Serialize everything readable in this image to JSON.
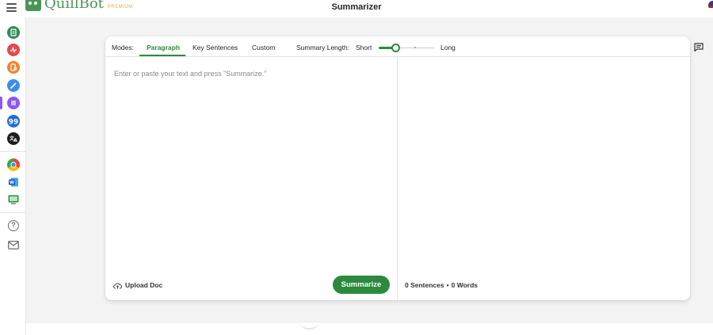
{
  "header": {
    "logo_text": "QuillBot",
    "logo_badge": "PREMIUM",
    "page_title": "Summarizer"
  },
  "sidebar": {
    "items": [
      {
        "name": "paraphraser",
        "icon": "document-icon",
        "color": "#2e8b57"
      },
      {
        "name": "grammar-checker",
        "icon": "pulse-icon",
        "color": "#e24b4b"
      },
      {
        "name": "plagiarism-checker",
        "icon": "report-icon",
        "color": "#f0842d"
      },
      {
        "name": "co-writer",
        "icon": "pen-icon",
        "color": "#3b8fe8"
      },
      {
        "name": "summarizer",
        "icon": "list-icon",
        "color": "#8b57f5",
        "active": true
      },
      {
        "name": "citation-generator",
        "icon": "quote-icon",
        "color": "#1f6fd6"
      },
      {
        "name": "translator",
        "icon": "translate-icon",
        "color": "#1d1d1d"
      }
    ],
    "extensions": [
      {
        "name": "chrome-extension",
        "icon": "chrome-icon"
      },
      {
        "name": "word-extension",
        "icon": "word-icon"
      },
      {
        "name": "desktop-app",
        "icon": "monitor-icon"
      }
    ],
    "footer": [
      {
        "name": "help",
        "icon": "help-icon"
      },
      {
        "name": "contact",
        "icon": "mail-icon"
      }
    ]
  },
  "toolbar": {
    "modes_label": "Modes:",
    "tabs": [
      "Paragraph",
      "Key Sentences",
      "Custom"
    ],
    "active_tab": "Paragraph",
    "length_label": "Summary Length:",
    "length_min": "Short",
    "length_max": "Long",
    "length_value": 0.3
  },
  "input": {
    "placeholder": "Enter or paste your text and press \"Summarize.\""
  },
  "actions": {
    "upload_label": "Upload Doc",
    "summarize_label": "Summarize"
  },
  "output": {
    "sentences": "0 Sentences",
    "separator": "•",
    "words": "0 Words"
  },
  "colors": {
    "accent": "#2b8a3e",
    "summarizer_purple": "#8b57f5"
  }
}
